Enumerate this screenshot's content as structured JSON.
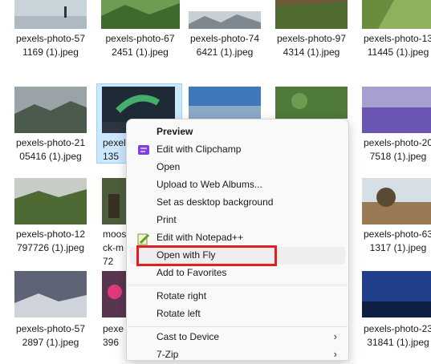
{
  "files": {
    "r1c1": "pexels-photo-57\n1169 (1).jpeg",
    "r1c2": "pexels-photo-67\n2451 (1).jpeg",
    "r1c3": "pexels-photo-74\n6421 (1).jpeg",
    "r1c4": "pexels-photo-97\n4314 (1).jpeg",
    "r1c5": "pexels-photo-13\n11445 (1).jpeg",
    "r2c1": "pexels-photo-21\n05416 (1).jpeg",
    "r2c2": "pexel\n135",
    "r2c5": "pexels-photo-20\n7518 (1).jpeg",
    "r3c1": "pexels-photo-12\n797726 (1).jpeg",
    "r3c2": "moos\nck-m\n72",
    "r3c5": "pexels-photo-63\n1317 (1).jpeg",
    "r4c1": "pexels-photo-57\n2897 (1).jpeg",
    "r4c2": "pexe\n396",
    "r4c5": "pexels-photo-23\n31841 (1).jpeg"
  },
  "context_menu": {
    "preview": "Preview",
    "edit_clipchamp": "Edit with Clipchamp",
    "open": "Open",
    "upload_web_albums": "Upload to Web Albums...",
    "set_desktop_bg": "Set as desktop background",
    "print": "Print",
    "edit_notepadpp": "Edit with Notepad++",
    "open_with_fly": "Open with Fly",
    "add_favorites": "Add to Favorites",
    "rotate_right": "Rotate right",
    "rotate_left": "Rotate left",
    "cast_device": "Cast to Device",
    "seven_zip": "7-Zip",
    "chevron": "›"
  },
  "colors": {
    "highlight": "#e02020",
    "selection": "#cce8ff",
    "clipchamp_icon": "#7b3fe4"
  },
  "icons": [
    "clipchamp-icon",
    "notepadpp-icon",
    "chevron-right-icon"
  ]
}
